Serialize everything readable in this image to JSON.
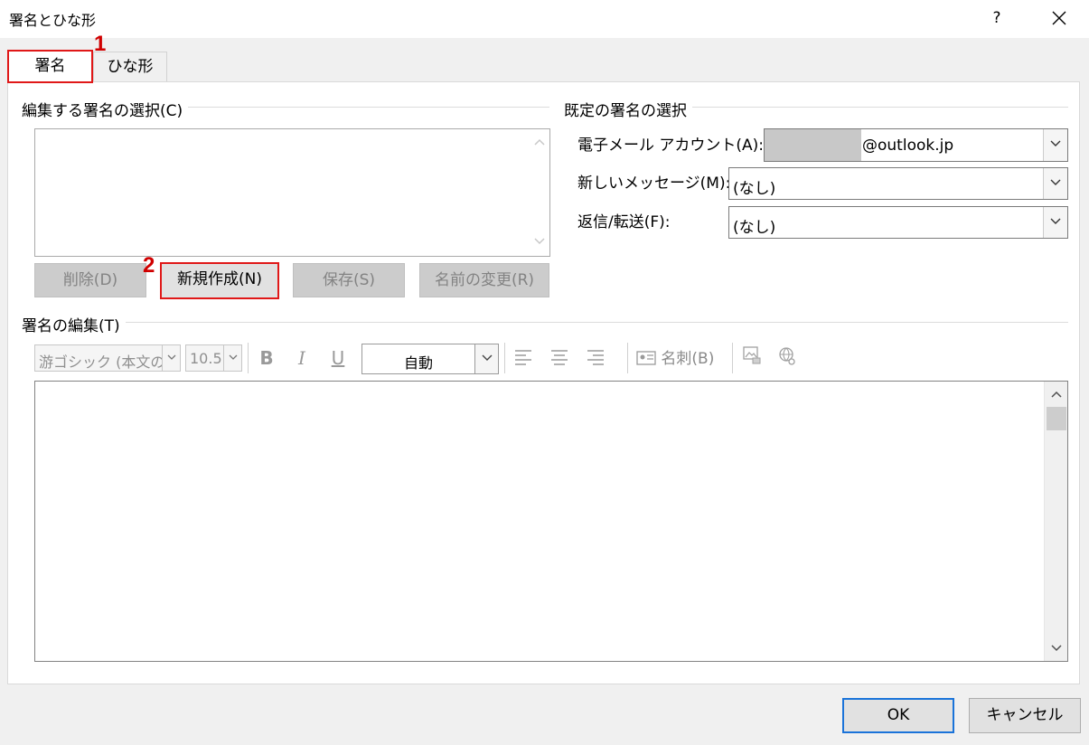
{
  "window": {
    "title": "署名とひな形",
    "help_icon": "?",
    "close_icon": "close-icon"
  },
  "tabs": [
    {
      "label": "署名",
      "selected": true
    },
    {
      "label": "ひな形",
      "selected": false
    }
  ],
  "markers": {
    "one": "1",
    "two": "2"
  },
  "edit_group": {
    "label": "編集する署名の選択(C)",
    "buttons": {
      "delete": "削除(D)",
      "new": "新規作成(N)",
      "save": "保存(S)",
      "rename": "名前の変更(R)"
    }
  },
  "default_group": {
    "label": "既定の署名の選択",
    "account_label": "電子メール アカウント(A):",
    "account_value": "@outlook.jp",
    "new_message_label": "新しいメッセージ(M):",
    "new_message_value": "(なし)",
    "reply_label": "返信/転送(F):",
    "reply_value": "(なし)"
  },
  "editor_group": {
    "label": "署名の編集(T)",
    "font_name": "游ゴシック (本文のフォント - 日本語)",
    "font_size": "10.5",
    "bold": "B",
    "italic": "I",
    "underline": "U",
    "color": "自動",
    "business_card": "名刺(B)"
  },
  "footer": {
    "ok": "OK",
    "cancel": "キャンセル"
  },
  "colors": {
    "highlight": "#e01818",
    "focus": "#1a73d9"
  }
}
